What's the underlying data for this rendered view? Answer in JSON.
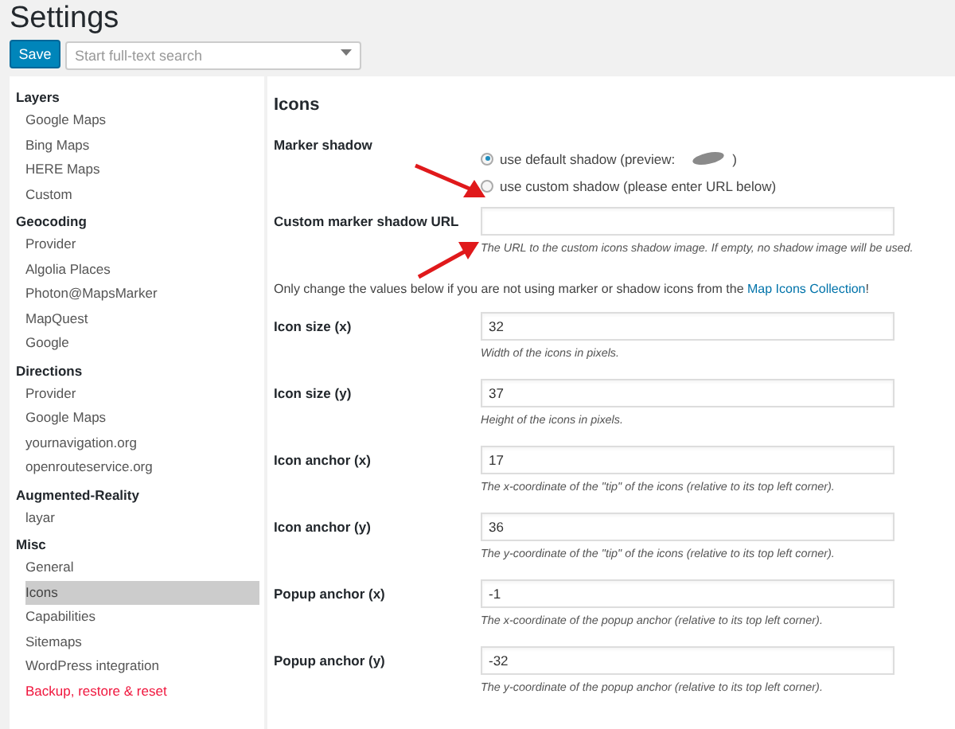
{
  "title": "Settings",
  "save_button": "Save",
  "search": {
    "placeholder": "Start full-text search"
  },
  "sidebar": [
    {
      "heading": "Layers",
      "items": [
        {
          "label": "Google Maps",
          "selected": false,
          "kind": "normal"
        },
        {
          "label": "Bing Maps",
          "selected": false,
          "kind": "normal"
        },
        {
          "label": "HERE Maps",
          "selected": false,
          "kind": "normal"
        },
        {
          "label": "Custom",
          "selected": false,
          "kind": "normal"
        }
      ]
    },
    {
      "heading": "Geocoding",
      "items": [
        {
          "label": "Provider",
          "selected": false,
          "kind": "normal"
        },
        {
          "label": "Algolia Places",
          "selected": false,
          "kind": "normal"
        },
        {
          "label": "Photon@MapsMarker",
          "selected": false,
          "kind": "normal"
        },
        {
          "label": "MapQuest",
          "selected": false,
          "kind": "normal"
        },
        {
          "label": "Google",
          "selected": false,
          "kind": "normal"
        }
      ]
    },
    {
      "heading": "Directions",
      "items": [
        {
          "label": "Provider",
          "selected": false,
          "kind": "normal"
        },
        {
          "label": "Google Maps",
          "selected": false,
          "kind": "normal"
        },
        {
          "label": "yournavigation.org",
          "selected": false,
          "kind": "normal"
        },
        {
          "label": "openrouteservice.org",
          "selected": false,
          "kind": "normal"
        }
      ]
    },
    {
      "heading": "Augmented-Reality",
      "items": [
        {
          "label": "layar",
          "selected": false,
          "kind": "normal"
        }
      ]
    },
    {
      "heading": "Misc",
      "items": [
        {
          "label": "General",
          "selected": false,
          "kind": "normal"
        },
        {
          "label": "Icons",
          "selected": true,
          "kind": "normal"
        },
        {
          "label": "Capabilities",
          "selected": false,
          "kind": "normal"
        },
        {
          "label": "Sitemaps",
          "selected": false,
          "kind": "normal"
        },
        {
          "label": "WordPress integration",
          "selected": false,
          "kind": "normal"
        },
        {
          "label": "Backup, restore & reset",
          "selected": false,
          "kind": "danger"
        }
      ]
    }
  ],
  "section_title": "Icons",
  "marker_shadow": {
    "label": "Marker shadow",
    "options": [
      {
        "label": "use default shadow (preview:",
        "closing": ")",
        "selected": true
      },
      {
        "label": "use custom shadow (please enter URL below)",
        "selected": false
      }
    ]
  },
  "shadow_url": {
    "label": "Custom marker shadow URL",
    "description": "The URL to the custom icons shadow image. If empty, no shadow image will be used."
  },
  "info": {
    "text": "Only change the values below if you are not using marker or shadow icons from the ",
    "link": "Map Icons Collection",
    "after": "!"
  },
  "fields": [
    {
      "label": "Icon size (x)",
      "value": "32",
      "description": "Width of the icons in pixels."
    },
    {
      "label": "Icon size (y)",
      "value": "37",
      "description": "Height of the icons in pixels."
    },
    {
      "label": "Icon anchor (x)",
      "value": "17",
      "description": "The x-coordinate of the \"tip\" of the icons (relative to its top left corner)."
    },
    {
      "label": "Icon anchor (y)",
      "value": "36",
      "description": "The y-coordinate of the \"tip\" of the icons (relative to its top left corner)."
    },
    {
      "label": "Popup anchor (x)",
      "value": "-1",
      "description": "The x-coordinate of the popup anchor (relative to its top left corner)."
    },
    {
      "label": "Popup anchor (y)",
      "value": "-32",
      "description": "The y-coordinate of the popup anchor (relative to its top left corner)."
    }
  ]
}
